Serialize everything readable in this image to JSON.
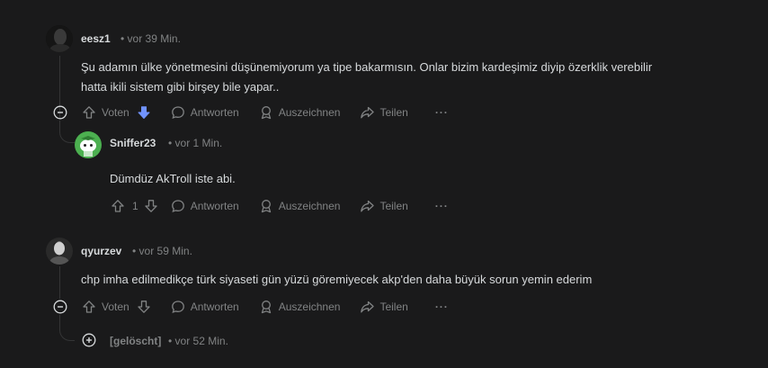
{
  "comments": [
    {
      "author": "eesz1",
      "time": "vor 39 Min.",
      "body_line1": "Şu adamın ülke yönetmesini düşünemiyorum ya tipe bakarmısın. Onlar bizim kardeşimiz diyip özerklik verebilir",
      "body_line2": "hatta ikili sistem gibi birşey bile yapar..",
      "vote_label": "Voten",
      "reply_label": "Antworten",
      "award_label": "Auszeichnen",
      "share_label": "Teilen",
      "more_label": "···",
      "downvoted": true
    },
    {
      "author": "Sniffer23",
      "time": "vor 1 Min.",
      "body": "Dümdüz AkTroll iste abi.",
      "score": "1",
      "reply_label": "Antworten",
      "award_label": "Auszeichnen",
      "share_label": "Teilen",
      "more_label": "···"
    },
    {
      "author": "qyurzev",
      "time": "vor 59 Min.",
      "body": "chp imha edilmedikçe türk siyaseti gün yüzü göremiyecek akp'den daha büyük sorun yemin ederim",
      "vote_label": "Voten",
      "reply_label": "Antworten",
      "award_label": "Auszeichnen",
      "share_label": "Teilen",
      "more_label": "···"
    },
    {
      "author": "[gelöscht]",
      "time": "vor 52 Min."
    }
  ],
  "separator": "•",
  "colors": {
    "background": "#1a1a1b",
    "downvote_active": "#7193ff",
    "muted": "#818384",
    "text": "#d7dadc"
  }
}
